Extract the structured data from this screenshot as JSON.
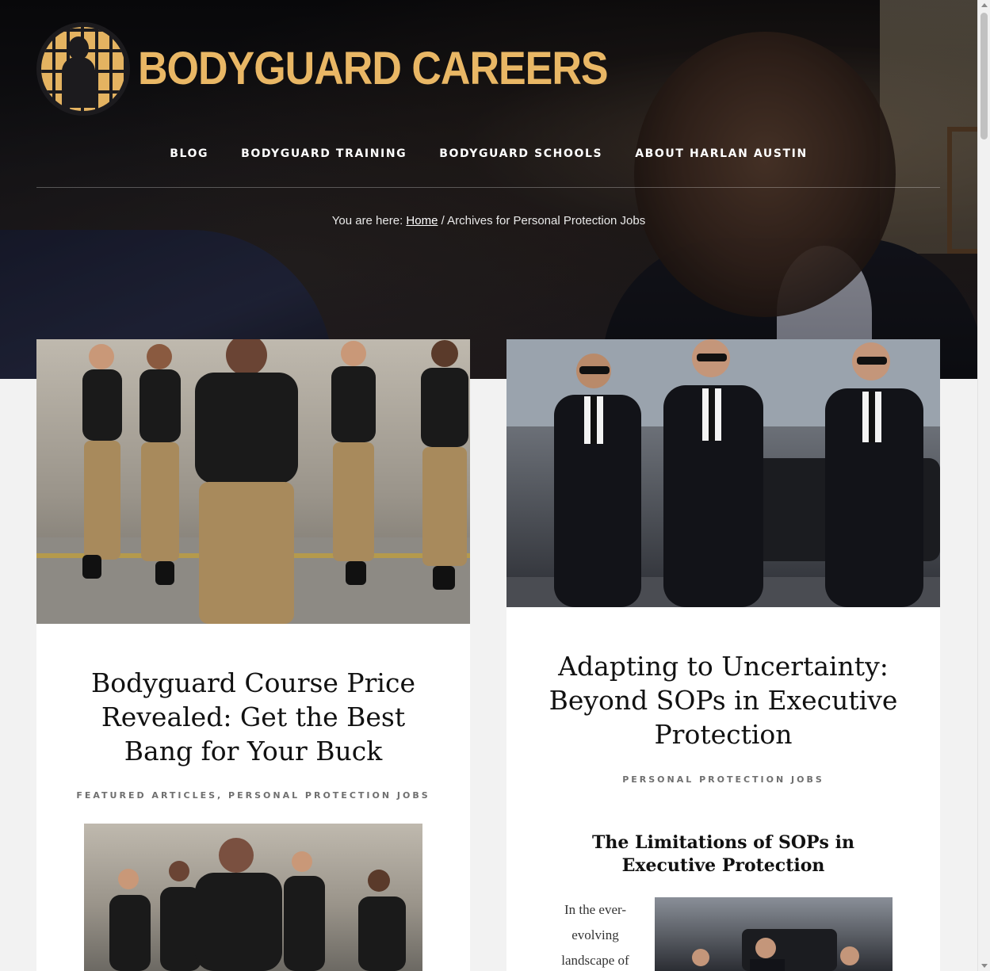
{
  "site": {
    "logo_text": "BODYGUARD CAREERS",
    "brand_color": "#e9b765"
  },
  "nav": {
    "items": [
      {
        "label": "BLOG"
      },
      {
        "label": "BODYGUARD TRAINING"
      },
      {
        "label": "BODYGUARD SCHOOLS"
      },
      {
        "label": "ABOUT HARLAN AUSTIN"
      }
    ]
  },
  "breadcrumb": {
    "prefix": "You are here: ",
    "home": "Home",
    "separator": " / ",
    "current": "Archives for Personal Protection Jobs"
  },
  "posts": [
    {
      "title": "Bodyguard Course Price Revealed: Get the Best Bang for Your Buck",
      "categories": [
        "FEATURED ARTICLES",
        "PERSONAL PROTECTION JOBS"
      ],
      "category_separator": ", ",
      "image_icon": "running-trainees-image"
    },
    {
      "title": "Adapting to Uncertainty: Beyond SOPs in Executive Protection",
      "categories": [
        "PERSONAL PROTECTION JOBS"
      ],
      "subheading": "The Limitations of SOPs in Executive Protection",
      "excerpt_lines": [
        "In the ever-",
        "evolving",
        "landscape of"
      ],
      "image_icon": "suited-bodyguards-image"
    }
  ]
}
